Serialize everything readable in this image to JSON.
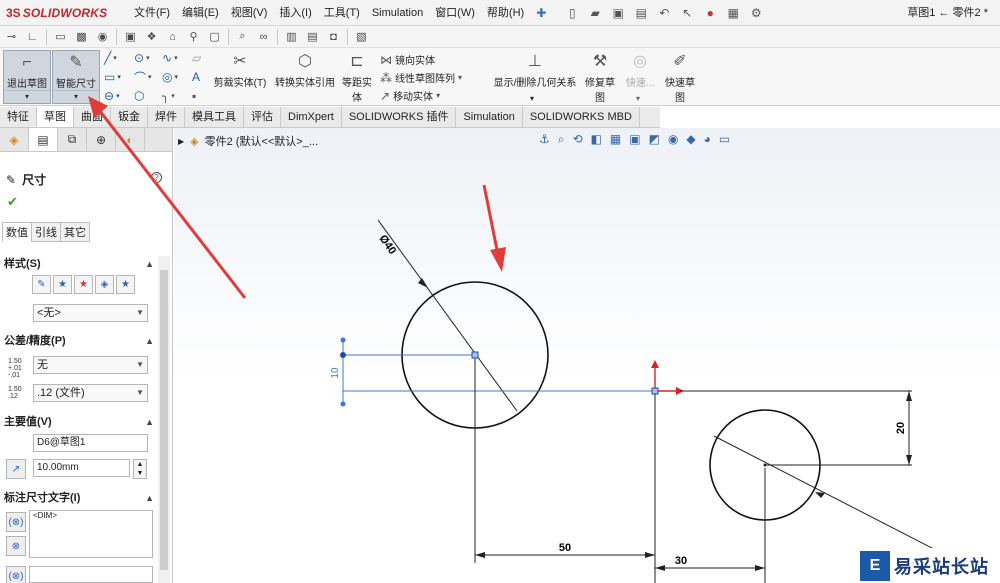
{
  "app": {
    "brand_ds": "3S",
    "brand_name": "SOLIDWORKS",
    "document_title": "草图1 ← 零件2 *"
  },
  "menu": [
    "文件(F)",
    "编辑(E)",
    "视图(V)",
    "插入(I)",
    "工具(T)",
    "Simulation",
    "窗口(W)",
    "帮助(H)"
  ],
  "ribbon": {
    "exit_sketch": "退出草图",
    "smart_dimension": "智能尺寸",
    "trim": "剪裁实体(T)",
    "convert": "转换实体引用",
    "offset": "等距实体",
    "mirror": "镜向实体",
    "linear_pattern": "线性草图阵列",
    "move": "移动实体",
    "display_relations": "显示/删除几何关系",
    "repair": "修复草图",
    "quick_snaps_disabled": "快速...",
    "quick_sketch": "快速草图"
  },
  "tabs": [
    "特征",
    "草图",
    "曲面",
    "钣金",
    "焊件",
    "模具工具",
    "评估",
    "DimXpert",
    "SOLIDWORKS 插件",
    "Simulation",
    "SOLIDWORKS MBD"
  ],
  "active_tab": "草图",
  "property_manager": {
    "title": "尺寸",
    "help": "?",
    "subtabs": [
      "数值",
      "引线",
      "其它"
    ],
    "style_group": "样式(S)",
    "style_select": "<无>",
    "tolerance_group": "公差/精度(P)",
    "tolerance_type": "无",
    "tolerance_icon": "1.50 +.01 -.01",
    "precision_icon": "1.50 .12",
    "precision": ".12 (文件)",
    "primary_group": "主要值(V)",
    "primary_name": "D6@草图1",
    "primary_value": "10.00mm",
    "text_group": "标注尺寸文字(I)",
    "text_value": "<DIM>"
  },
  "graphics": {
    "tree_label": "零件2 (默认<<默认>_..."
  },
  "dimensions": {
    "diameter": "Ø40",
    "vertical_small": "10",
    "horizontal_50": "50",
    "horizontal_30": "30",
    "vertical_20": "20"
  },
  "colors": {
    "accent_red": "#e03c3c",
    "dim_blue": "#3a78d8",
    "ribbon_active": "#cfd6de",
    "brand": "#c0282d"
  },
  "watermark": {
    "logo": "E",
    "text": "易采站长站"
  }
}
